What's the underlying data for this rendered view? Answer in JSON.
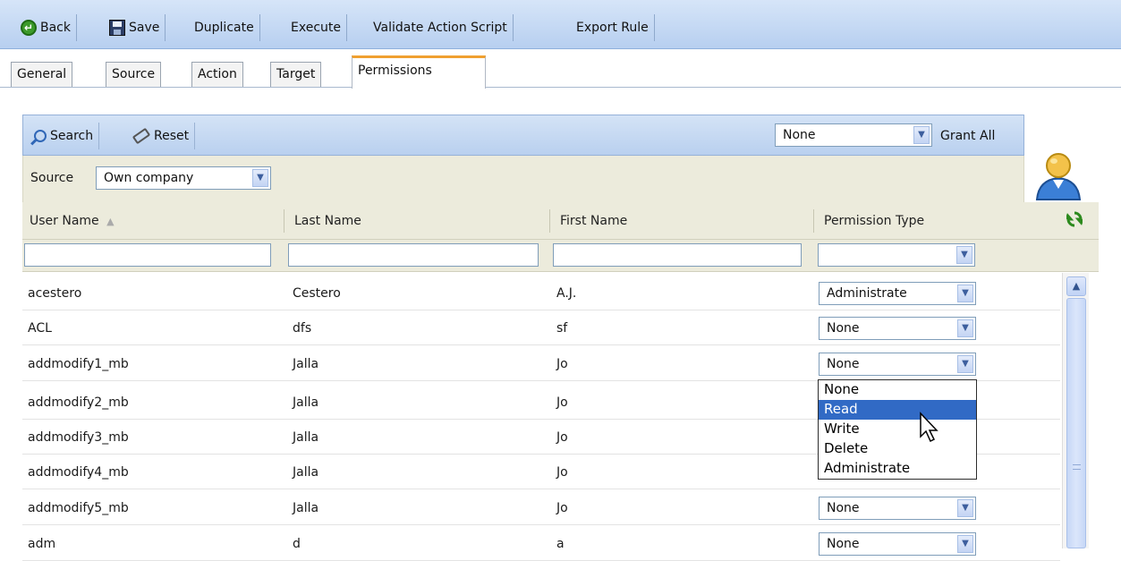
{
  "toolbar": {
    "back": "Back",
    "save": "Save",
    "duplicate": "Duplicate",
    "execute": "Execute",
    "validate": "Validate Action Script",
    "export": "Export Rule"
  },
  "tabs": [
    "General",
    "Source",
    "Action",
    "Target",
    "Permissions"
  ],
  "active_tab": "Permissions",
  "grid_toolbar": {
    "search": "Search",
    "reset": "Reset",
    "grant_value": "None",
    "grant_all": "Grant All"
  },
  "source_filter": {
    "label": "Source",
    "value": "Own company"
  },
  "columns": {
    "user_name": "User Name",
    "last_name": "Last Name",
    "first_name": "First Name",
    "permission_type": "Permission Type"
  },
  "rows": [
    {
      "user": "acestero",
      "last": "Cestero",
      "first": "A.J.",
      "perm": "Administrate"
    },
    {
      "user": "ACL",
      "last": "dfs",
      "first": "sf",
      "perm": "None"
    },
    {
      "user": "addmodify1_mb",
      "last": "Jalla",
      "first": "Jo",
      "perm": "None"
    },
    {
      "user": "addmodify2_mb",
      "last": "Jalla",
      "first": "Jo",
      "perm": ""
    },
    {
      "user": "addmodify3_mb",
      "last": "Jalla",
      "first": "Jo",
      "perm": ""
    },
    {
      "user": "addmodify4_mb",
      "last": "Jalla",
      "first": "Jo",
      "perm": ""
    },
    {
      "user": "addmodify5_mb",
      "last": "Jalla",
      "first": "Jo",
      "perm": "None"
    },
    {
      "user": "adm",
      "last": "d",
      "first": "a",
      "perm": "None"
    }
  ],
  "dropdown_options": [
    "None",
    "Read",
    "Write",
    "Delete",
    "Administrate"
  ],
  "dropdown_highlighted": "Read",
  "colors": {
    "toolbar_bg": "#c6daf4",
    "active_tab_accent": "#f0a030",
    "header_bg": "#ecebdc",
    "selection": "#316ac5"
  }
}
